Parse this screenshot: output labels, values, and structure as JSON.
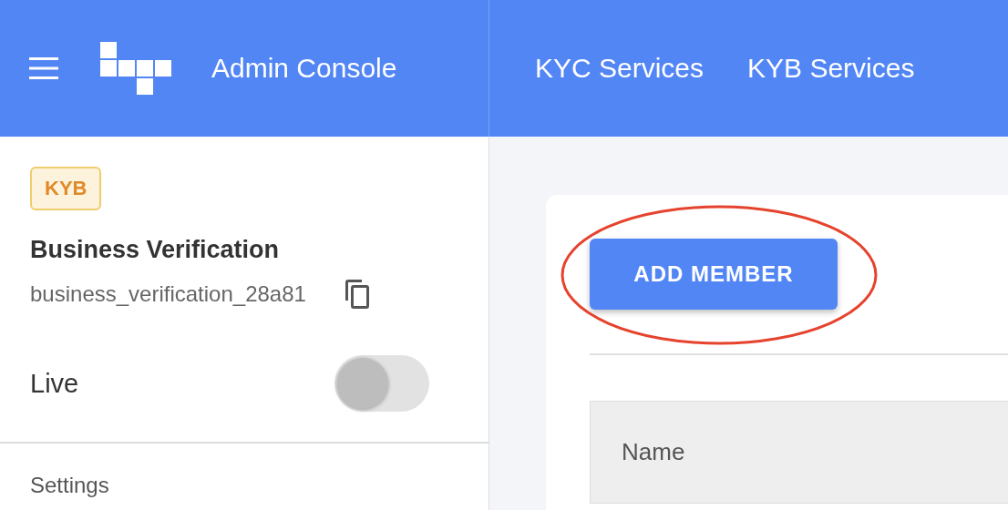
{
  "header": {
    "title": "Admin Console",
    "nav": [
      {
        "label": "KYC Services"
      },
      {
        "label": "KYB Services"
      }
    ]
  },
  "sidebar": {
    "badge": "KYB",
    "name": "Business Verification",
    "identifier": "business_verification_28a81",
    "live": {
      "label": "Live",
      "on": false
    },
    "section": "Settings"
  },
  "main": {
    "add_button": "ADD MEMBER",
    "table": {
      "columns": [
        "Name"
      ]
    },
    "annotations": [
      {
        "kind": "ellipse"
      }
    ]
  }
}
